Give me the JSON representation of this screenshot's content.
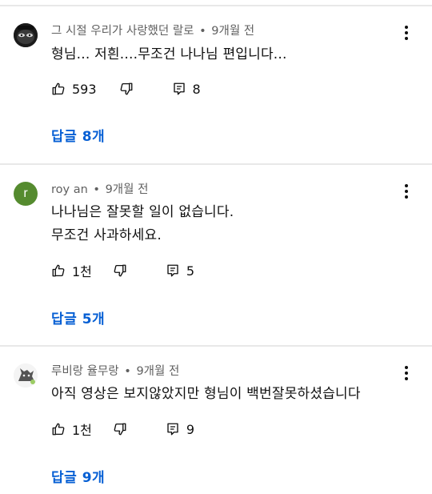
{
  "comments": [
    {
      "author": "그 시절 우리가 사랑했던 랄로",
      "time": "9개월 전",
      "lines": [
        "형님... 저흰....무조건 나나님 편입니다..."
      ],
      "likes": "593",
      "replies_count": "8",
      "replies_label": "답글 8개",
      "avatar_icon": "dark-photo-avatar"
    },
    {
      "author": "roy an",
      "time": "9개월 전",
      "lines": [
        "나나님은 잘못할 일이 없습니다.",
        "무조건 사과하세요."
      ],
      "likes": "1천",
      "replies_count": "5",
      "replies_label": "답글 5개",
      "avatar_letter": "r",
      "avatar_color": "#558b2f"
    },
    {
      "author": "루비랑 율무랑",
      "time": "9개월 전",
      "lines": [
        "아직 영상은 보지않았지만 형님이 백번잘못하셨습니다"
      ],
      "likes": "1천",
      "replies_count": "9",
      "replies_label": "답글 9개",
      "avatar_icon": "character-avatar"
    }
  ],
  "separator": "•",
  "icons": {
    "like": "thumbs-up-icon",
    "dislike": "thumbs-down-icon",
    "reply": "reply-comment-icon",
    "more": "more-vertical-icon"
  },
  "colors": {
    "link": "#065fd4",
    "meta": "#606060",
    "divider": "#e8e8e8"
  }
}
